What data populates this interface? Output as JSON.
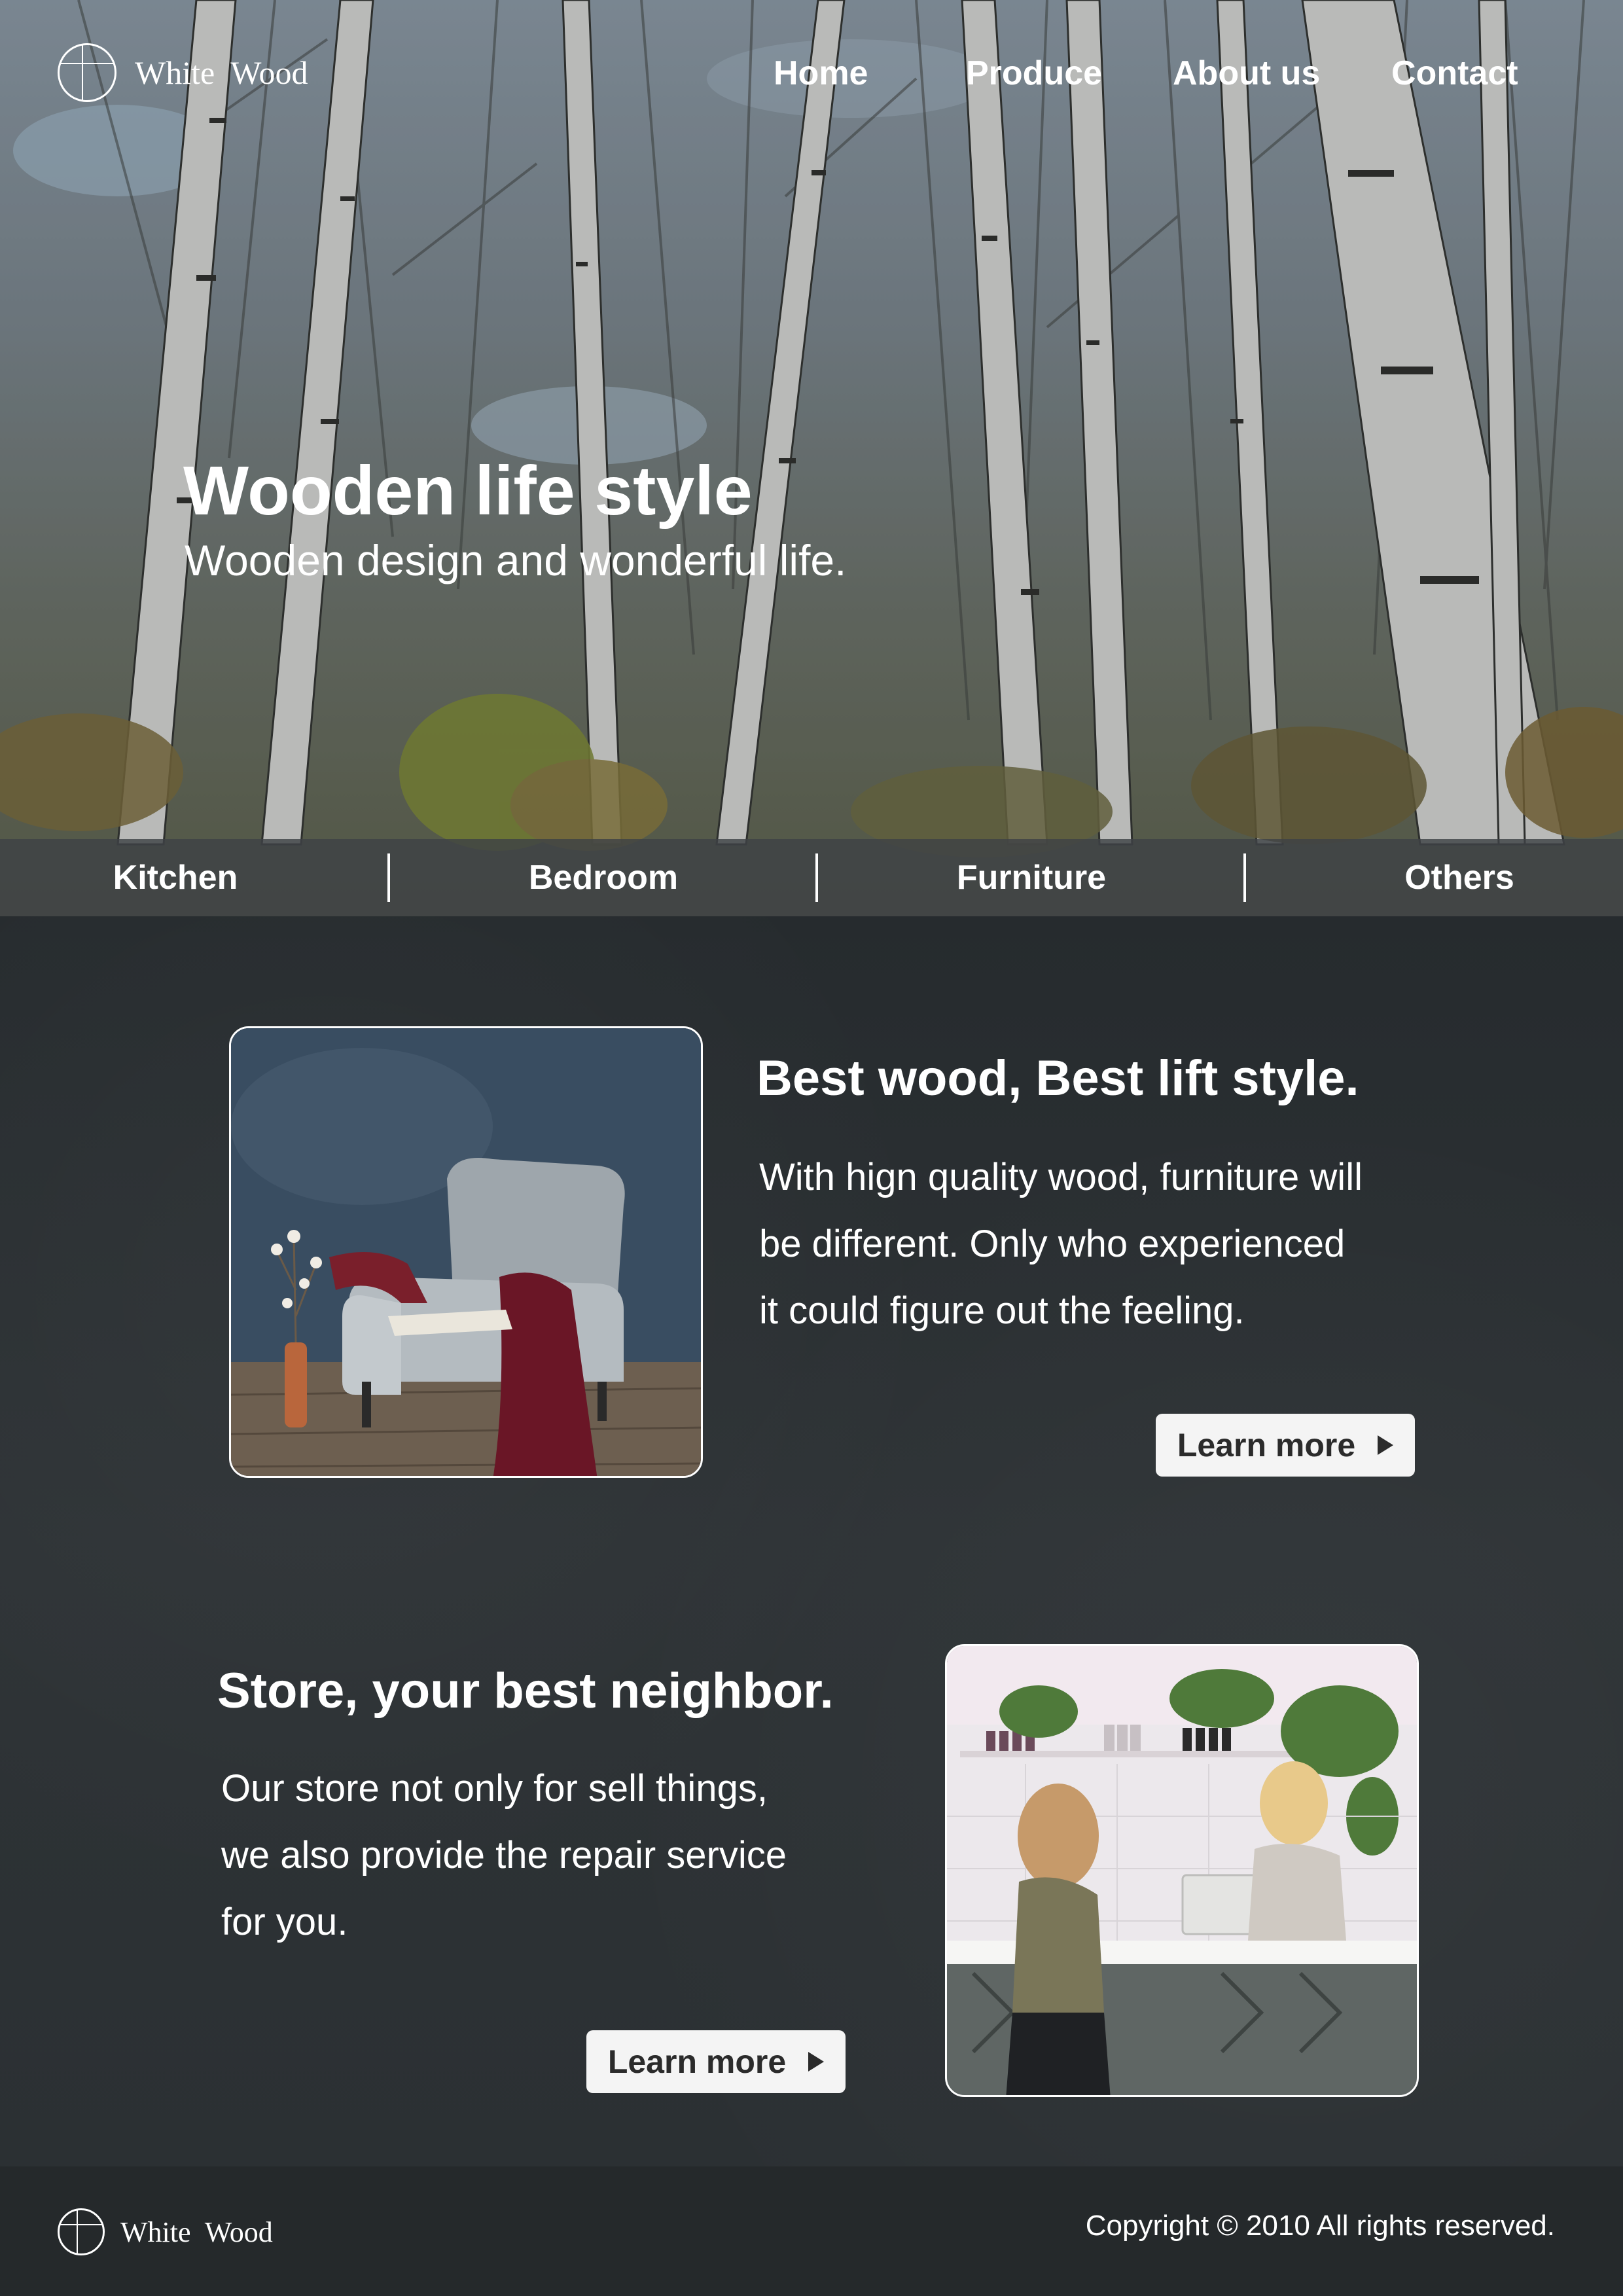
{
  "brand": {
    "name": "White  Wood",
    "logo_icon": "circle-cross-logo-icon"
  },
  "nav": {
    "items": [
      {
        "label": "Home"
      },
      {
        "label": "Produce"
      },
      {
        "label": "About us"
      },
      {
        "label": "Contact"
      }
    ]
  },
  "hero": {
    "title": "Wooden life style",
    "subtitle": "Wooden design and wonderful life."
  },
  "categories": [
    {
      "label": "Kitchen"
    },
    {
      "label": "Bedroom"
    },
    {
      "label": "Furniture"
    },
    {
      "label": "Others"
    }
  ],
  "sections": [
    {
      "title": "Best wood, Best lift style.",
      "body_lines": [
        "With hign quality wood, furniture will",
        "be different. Only who experienced",
        "it could figure out the feeling."
      ],
      "button_label": "Learn more",
      "button_icon": "play-icon",
      "image": "armchair-photo"
    },
    {
      "title": "Store, your best neighbor.",
      "body_lines": [
        "Our store not only for sell things,",
        "we also provide the repair service",
        "for you."
      ],
      "button_label": "Learn more",
      "button_icon": "play-icon",
      "image": "store-counter-photo"
    }
  ],
  "footer": {
    "brand": "White  Wood",
    "copyright": "Copyright © 2010 All rights reserved."
  },
  "colors": {
    "page_background": "#2b3033",
    "footer_background": "#25292b",
    "category_bar": "#3e4246",
    "button_background": "#f4f4f4",
    "text": "#ffffff"
  }
}
